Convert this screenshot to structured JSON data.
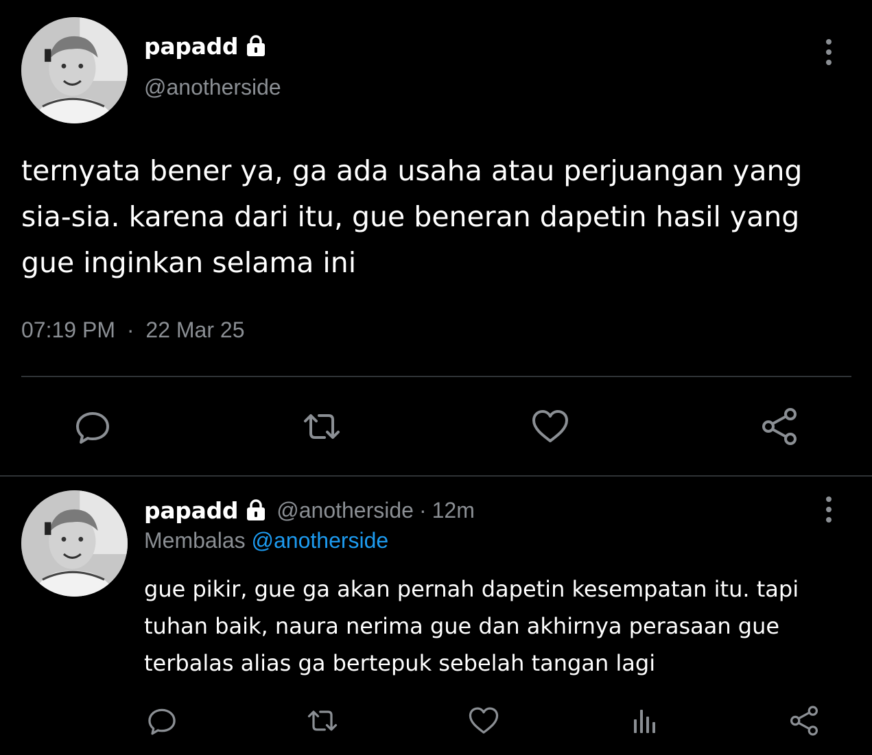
{
  "tweet": {
    "display_name": "papadd",
    "handle": "@anotherside",
    "text_lines": [
      "ternyata bener ya, ga ada usaha atau perjuangan yang",
      "sia-sia. karena dari itu, gue beneran dapetin hasil yang",
      "gue inginkan selama ini"
    ],
    "time": "07:19 PM",
    "separator": "·",
    "date": "22 Mar 25"
  },
  "reply": {
    "display_name": "papadd",
    "handle": "@anotherside",
    "dot": "·",
    "age": "12m",
    "replying_label": "Membalas",
    "replying_to": "@anotherside",
    "text_lines": [
      "gue pikir, gue ga akan pernah dapetin kesempatan itu. tapi",
      "tuhan baik, naura nerima gue dan akhirnya perasaan gue",
      "terbalas alias ga bertepuk sebelah tangan lagi"
    ]
  },
  "icons": {
    "lock": "lock-icon",
    "reply": "comment-icon",
    "retweet": "retweet-icon",
    "like": "heart-icon",
    "share": "share-icon",
    "views": "views-icon",
    "more": "more-vertical-icon"
  },
  "colors": {
    "background": "#000000",
    "text": "#ffffff",
    "muted": "#8b8f94",
    "link": "#1d9bf0",
    "divider": "#2f3336"
  }
}
